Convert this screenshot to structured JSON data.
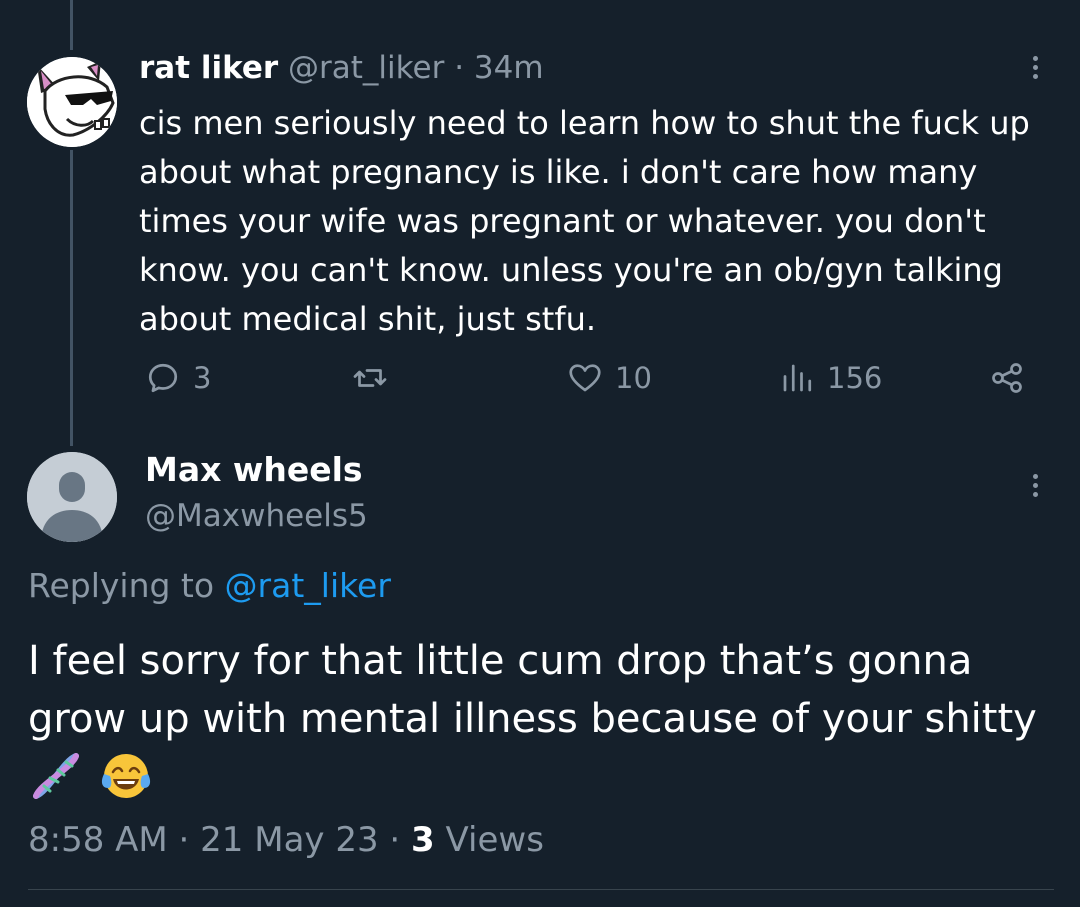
{
  "tweet": {
    "display_name": "rat liker",
    "handle": "@rat_liker",
    "separator": "·",
    "time": "34m",
    "text": "cis men seriously need to learn how to shut the fuck up about what pregnancy is like. i don't care how many times your wife was pregnant or whatever. you don't know. you can't know. unless you're an ob/gyn talking about medical shit, just stfu.",
    "avatar_icon": "rat-with-sunglasses-avatar",
    "actions": {
      "replies": "3",
      "retweets": "",
      "likes": "10",
      "views": "156"
    }
  },
  "reply": {
    "display_name": "Max wheels",
    "handle": "@Maxwheels5",
    "replying_prefix": "Replying to",
    "replying_handle": "@rat_liker",
    "text": "I feel sorry for that little cum drop that’s gonna grow up with mental illness because of your shitty",
    "emojis": [
      "dna-emoji",
      "tears-of-joy-emoji"
    ],
    "timestamp": "8:58 AM · 21 May 23 ·",
    "views_count": "3",
    "views_label": "Views"
  },
  "colors": {
    "background": "#15202b",
    "muted": "#8b98a5",
    "link": "#1d9bf0",
    "thread_line": "#425364"
  }
}
